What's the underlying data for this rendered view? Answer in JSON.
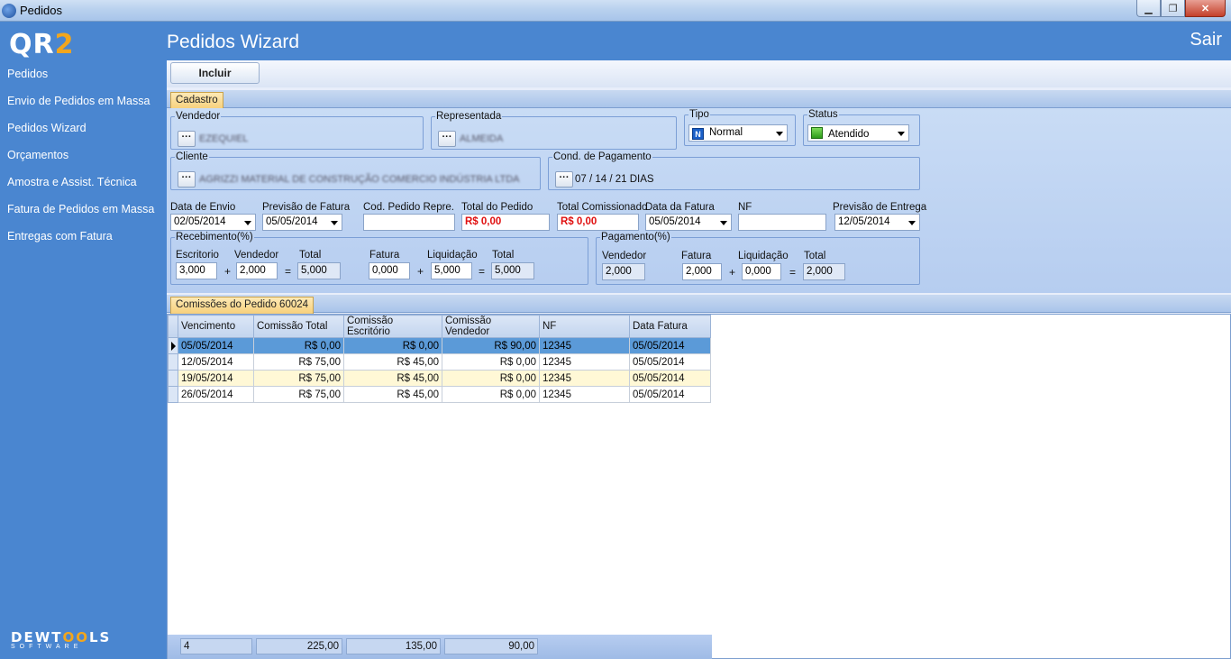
{
  "window": {
    "title": "Pedidos",
    "minimize": "▁",
    "maximize": "❐",
    "close": "✕"
  },
  "sidebar": {
    "logo_a": "QR",
    "logo_b": "2",
    "items": [
      {
        "label": "Pedidos"
      },
      {
        "label": "Envio de Pedidos em Massa"
      },
      {
        "label": "Pedidos Wizard"
      },
      {
        "label": "Orçamentos"
      },
      {
        "label": "Amostra e Assist. Técnica"
      },
      {
        "label": "Fatura de Pedidos em Massa"
      },
      {
        "label": "Entregas com Fatura"
      }
    ],
    "brand_a": "DEWT",
    "brand_b": "OO",
    "brand_c": "LS",
    "brand_sub": "SOFTWARE"
  },
  "header": {
    "title": "Pedidos Wizard",
    "exit": "Sair"
  },
  "toolbar": {
    "incluir": "Incluir"
  },
  "cadastro": {
    "tab": "Cadastro",
    "vendedor": {
      "label": "Vendedor",
      "value": "EZEQUIEL"
    },
    "representada": {
      "label": "Representada",
      "value": "ALMEIDA"
    },
    "tipo": {
      "label": "Tipo",
      "value": "Normal",
      "icon": "N"
    },
    "status": {
      "label": "Status",
      "value": "Atendido"
    },
    "cliente": {
      "label": "Cliente",
      "value": "AGRIZZI MATERIAL DE CONSTRUÇÃO COMERCIO INDÚSTRIA LTDA"
    },
    "cond_pagamento": {
      "label": "Cond. de Pagamento",
      "value": "07 / 14 / 21 DIAS"
    },
    "dots": "···",
    "data_envio": {
      "label": "Data de Envio",
      "value": "02/05/2014"
    },
    "previsao_fatura": {
      "label": "Previsão de Fatura",
      "value": "05/05/2014"
    },
    "cod_pedido": {
      "label": "Cod. Pedido Repre.",
      "value": ""
    },
    "total_pedido": {
      "label": "Total do Pedido",
      "value": "R$ 0,00"
    },
    "total_comissionado": {
      "label": "Total Comissionado",
      "value": "R$ 0,00"
    },
    "data_fatura": {
      "label": "Data da Fatura",
      "value": "05/05/2014"
    },
    "nf": {
      "label": "NF",
      "value": ""
    },
    "previsao_entrega": {
      "label": "Previsão de Entrega",
      "value": "12/05/2014"
    },
    "recebimento": {
      "label": "Recebimento(%)",
      "escritorio_label": "Escritorio",
      "escritorio": "3,000",
      "vendedor_label": "Vendedor",
      "vendedor": "2,000",
      "total_label": "Total",
      "total": "5,000",
      "fatura_label": "Fatura",
      "fatura": "0,000",
      "liquidacao_label": "Liquidação",
      "liquidacao": "5,000",
      "total2_label": "Total",
      "total2": "5,000"
    },
    "pagamento": {
      "label": "Pagamento(%)",
      "vendedor_label": "Vendedor",
      "vendedor": "2,000",
      "fatura_label": "Fatura",
      "fatura": "2,000",
      "liquidacao_label": "Liquidação",
      "liquidacao": "0,000",
      "total_label": "Total",
      "total": "2,000"
    },
    "plus": "+",
    "equals": "="
  },
  "comissoes": {
    "tab": "Comissões do Pedido 60024",
    "columns": [
      "Vencimento",
      "Comissão Total",
      "Comissão Escritório",
      "Comissão Vendedor",
      "NF",
      "Data Fatura"
    ],
    "rows": [
      [
        "05/05/2014",
        "R$ 0,00",
        "R$ 0,00",
        "R$ 90,00",
        "12345",
        "05/05/2014"
      ],
      [
        "12/05/2014",
        "R$ 75,00",
        "R$ 45,00",
        "R$ 0,00",
        "12345",
        "05/05/2014"
      ],
      [
        "19/05/2014",
        "R$ 75,00",
        "R$ 45,00",
        "R$ 0,00",
        "12345",
        "05/05/2014"
      ],
      [
        "26/05/2014",
        "R$ 75,00",
        "R$ 45,00",
        "R$ 0,00",
        "12345",
        "05/05/2014"
      ]
    ],
    "footer": {
      "count": "4",
      "total": "225,00",
      "escritorio": "135,00",
      "vendedor": "90,00"
    }
  }
}
